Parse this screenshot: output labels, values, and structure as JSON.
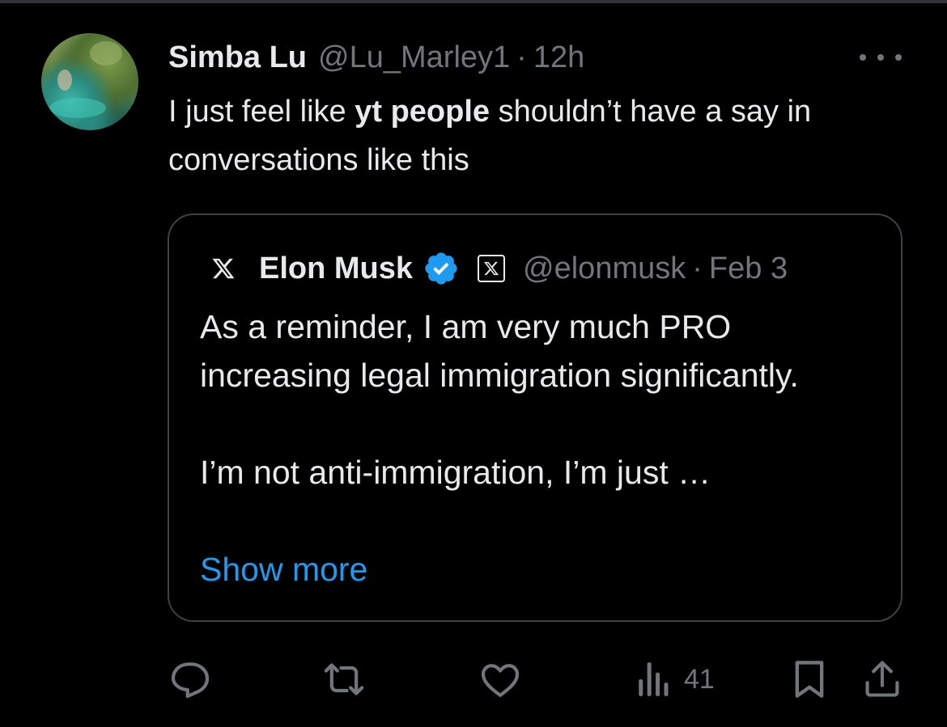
{
  "tweet": {
    "author_name": "Simba Lu",
    "handle": "@Lu_Marley1",
    "separator": "·",
    "time": "12h",
    "text_before": "I just feel like ",
    "text_bold": "yt people",
    "text_after": " shouldn’t have a say in conversations like this"
  },
  "quote": {
    "author_name": "Elon Musk",
    "handle": "@elonmusk",
    "separator": "·",
    "date": "Feb 3",
    "paragraph1": "As a reminder, I am very much PRO increasing legal immigration significantly.",
    "paragraph2": "I’m not anti-immigration, I’m just …",
    "show_more": "Show more"
  },
  "actions": {
    "views_count": "41"
  },
  "icons": {
    "reply": "reply-icon",
    "repost": "repost-icon",
    "like": "like-icon",
    "views": "views-icon",
    "bookmark": "bookmark-icon",
    "share": "share-icon",
    "more": "more-icon",
    "x_logo": "x-logo-icon",
    "verified": "verified-badge-icon"
  },
  "colors": {
    "background": "#000000",
    "text": "#e7e9ea",
    "muted": "#71767b",
    "link": "#1d9bf0",
    "verified": "#1d9bf0",
    "border": "#3e4144"
  }
}
